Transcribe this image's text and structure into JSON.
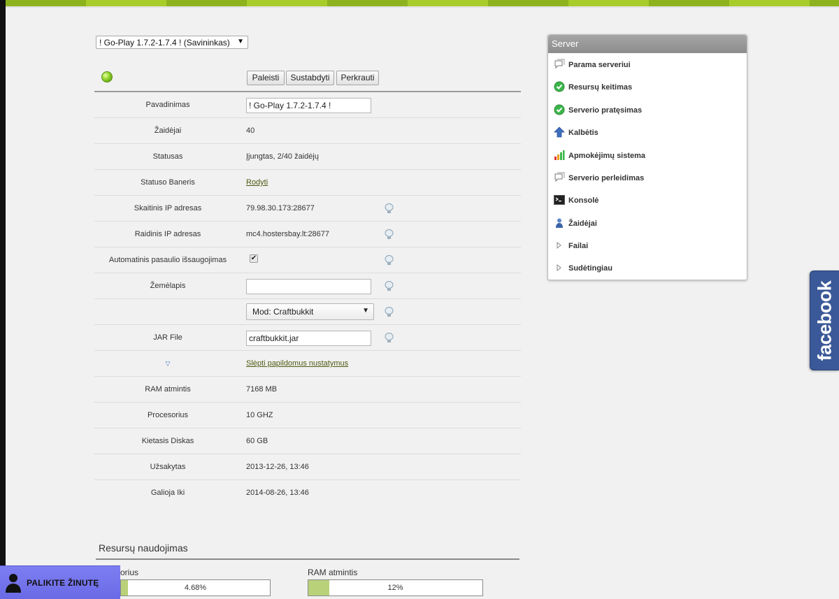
{
  "server_select": {
    "value": "! Go-Play 1.7.2-1.7.4 ! (Savininkas)"
  },
  "controls": {
    "start": "Paleisti",
    "stop": "Sustabdyti",
    "restart": "Perkrauti",
    "status_color": "#8fd12c"
  },
  "rows": {
    "name": {
      "label": "Pavadinimas",
      "value": "! Go-Play 1.7.2-1.7.4 !"
    },
    "players": {
      "label": "Žaidėjai",
      "value": "40"
    },
    "status": {
      "label": "Statusas",
      "value": "Įjungtas, 2/40 žaidėjų"
    },
    "banner": {
      "label": "Statuso Baneris",
      "link": "Rodyti"
    },
    "ip_num": {
      "label": "Skaitinis IP adresas",
      "value": "79.98.30.173:28677"
    },
    "ip_text": {
      "label": "Raidinis IP adresas",
      "value": "mc4.hostersbay.lt:28677"
    },
    "autosave": {
      "label": "Automatinis pasaulio išsaugojimas",
      "checked": "✔"
    },
    "map": {
      "label": "Žemėlapis",
      "value": ""
    },
    "mod": {
      "value": "Mod: Craftbukkit"
    },
    "jar": {
      "label": "JAR File",
      "value": "craftbukkit.jar"
    },
    "advanced": {
      "link": "Slėpti papildomus nustatymus"
    },
    "ram": {
      "label": "RAM atmintis",
      "value": "7168 MB"
    },
    "cpu": {
      "label": "Procesorius",
      "value": "10 GHZ"
    },
    "disk": {
      "label": "Kietasis Diskas",
      "value": "60 GB"
    },
    "ordered": {
      "label": "Užsakytas",
      "value": "2013-12-26, 13:46"
    },
    "expires": {
      "label": "Galioja Iki",
      "value": "2014-08-26, 13:46"
    }
  },
  "resources": {
    "title": "Resursų naudojimas",
    "cpu": {
      "label": "orius",
      "value": "4.68%",
      "fraction": 0.0468
    },
    "ram": {
      "label": "RAM atmintis",
      "value": "12%",
      "fraction": 0.12
    }
  },
  "panel": {
    "title": "Server",
    "items": [
      {
        "label": "Parama serveriui",
        "icon": "speech-bubble-icon"
      },
      {
        "label": "Resursų keitimas",
        "icon": "green-check-icon"
      },
      {
        "label": "Serverio pratęsimas",
        "icon": "green-check-icon"
      },
      {
        "label": "Kalbėtis",
        "icon": "blue-up-arrow-icon"
      },
      {
        "label": "Apmokėjimų sistema",
        "icon": "signal-bars-icon"
      },
      {
        "label": "Serverio perleidimas",
        "icon": "speech-bubble-icon"
      },
      {
        "label": "Konsolė",
        "icon": "terminal-icon"
      },
      {
        "label": "Žaidėjai",
        "icon": "user-icon"
      },
      {
        "label": "Failai",
        "icon": "triangle-right-icon"
      },
      {
        "label": "Sudėtingiau",
        "icon": "triangle-right-icon"
      }
    ]
  },
  "facebook": {
    "label": "facebook"
  },
  "chat": {
    "label": "PALIKITE ŽINUTĘ"
  }
}
